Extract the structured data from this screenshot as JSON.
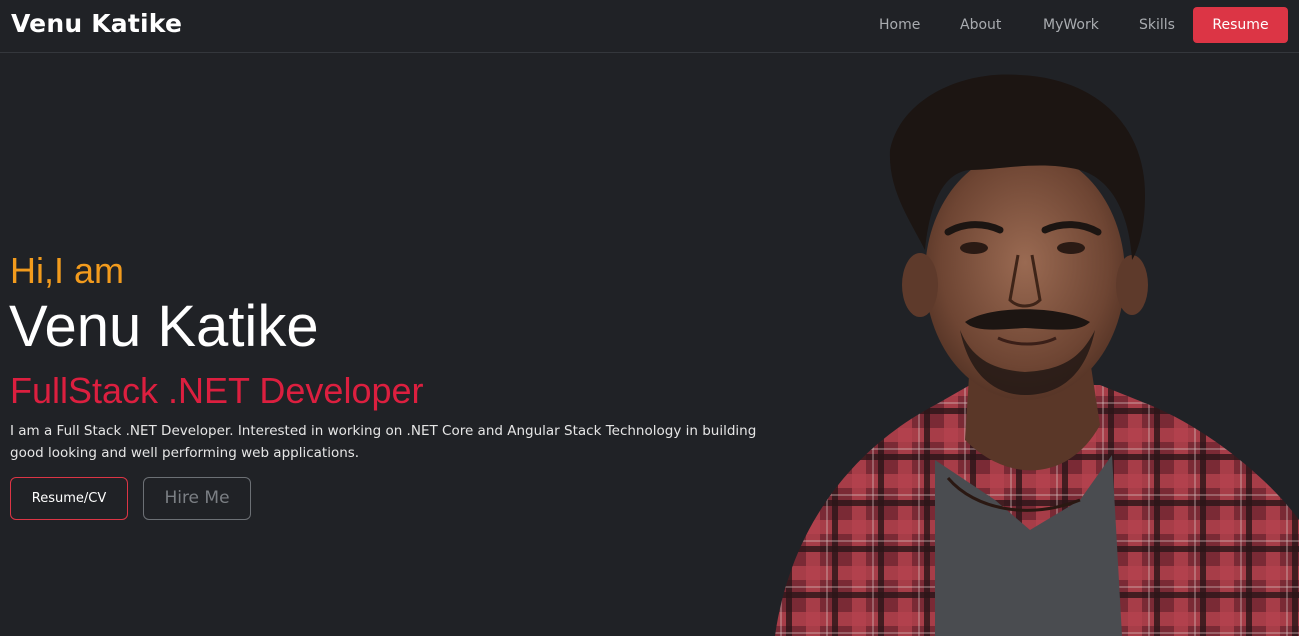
{
  "navbar": {
    "brand": "Venu Katike",
    "links": [
      {
        "label": "Home"
      },
      {
        "label": "About"
      },
      {
        "label": "MyWork"
      },
      {
        "label": "Skills"
      }
    ],
    "resume_button": "Resume"
  },
  "hero": {
    "greeting": "Hi,I am",
    "name": "Venu Katike",
    "role": "FullStack .NET Developer",
    "description": "I am a Full Stack .NET Developer. Interested in working on .NET Core and Angular Stack Technology in building good looking and well performing web applications.",
    "buttons": {
      "resume_cv": "Resume/CV",
      "hire_me": "Hire Me"
    }
  },
  "colors": {
    "background": "#202226",
    "accent_red": "#dc3545",
    "greeting_orange": "#f29b1d",
    "role_red": "#dc1f3f"
  }
}
